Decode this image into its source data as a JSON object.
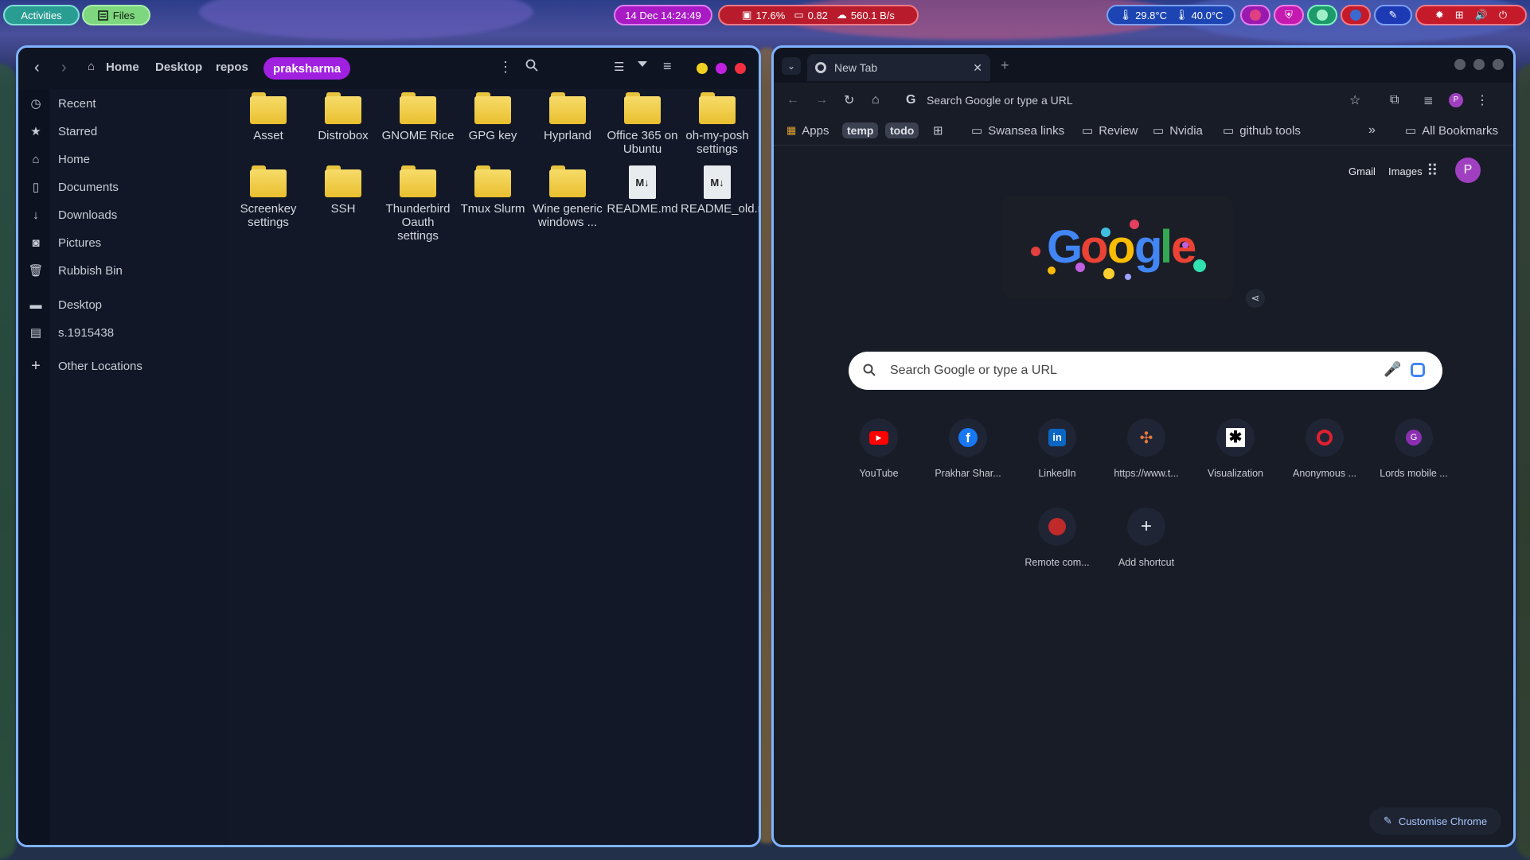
{
  "topbar": {
    "activities": "Activities",
    "files_app": "Files",
    "clock": "14 Dec  14:24:49",
    "cpu": "17.6%",
    "load": "0.82",
    "net": "560.1 B/s",
    "temp1": "29.8°C",
    "temp2": "40.0°C"
  },
  "files": {
    "breadcrumb": [
      "Home",
      "Desktop",
      "repos",
      "praksharma"
    ],
    "sidebar": {
      "recent": "Recent",
      "starred": "Starred",
      "home": "Home",
      "documents": "Documents",
      "downloads": "Downloads",
      "pictures": "Pictures",
      "rubbish": "Rubbish Bin",
      "desktop": "Desktop",
      "drive": "s.1915438",
      "other": "Other Locations"
    },
    "items": [
      "Asset",
      "Distrobox",
      "GNOME Rice",
      "GPG key",
      "Hyprland",
      "Office 365 on Ubuntu",
      "oh-my-posh settings",
      "Screenkey settings",
      "SSH",
      "Thunderbird Oauth settings",
      "Tmux Slurm",
      "Wine generic windows ...",
      "README.md",
      "README_old.md"
    ]
  },
  "chrome": {
    "tab_title": "New Tab",
    "omnibox": "Search Google or type a URL",
    "bookmarks": {
      "apps": "Apps",
      "temp": "temp",
      "todo": "todo",
      "swansea": "Swansea links",
      "review": "Review",
      "nvidia": "Nvidia",
      "github": "github tools",
      "all": "All Bookmarks"
    },
    "gmail": "Gmail",
    "images": "Images",
    "avatar_letter": "P",
    "search_placeholder": "Search Google or type a URL",
    "shortcuts": [
      "YouTube",
      "Prakhar Shar...",
      "LinkedIn",
      "https://www.t...",
      "Visualization",
      "Anonymous ...",
      "Lords mobile ...",
      "Remote com...",
      "Add shortcut"
    ],
    "lords_letter": "G",
    "customise": "Customise Chrome"
  },
  "colors": {
    "window_border": "#7fb3ff",
    "activities": "#2aa198",
    "files_pill": "#86e08a",
    "clock_pill": "#b01cc8",
    "sys_pill": "#c8202f",
    "weather_pill": "#1f47b8",
    "path_active": "#a020e0"
  }
}
